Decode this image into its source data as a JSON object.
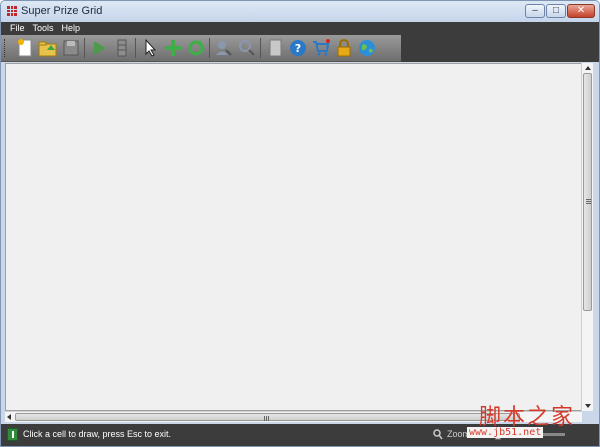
{
  "window": {
    "title": "Super Prize Grid"
  },
  "menu": {
    "items": [
      "File",
      "Tools",
      "Help"
    ]
  },
  "toolbar": {
    "buttons": [
      {
        "name": "new-file-icon"
      },
      {
        "name": "open-folder-icon"
      },
      {
        "name": "save-icon"
      },
      {
        "name": "play-icon"
      },
      {
        "name": "stack-icon"
      },
      {
        "name": "cursor-arrow-icon"
      },
      {
        "name": "move-cross-icon"
      },
      {
        "name": "refresh-icon"
      },
      {
        "name": "user-search-icon"
      },
      {
        "name": "user-zoom-icon"
      },
      {
        "name": "blank-page-icon"
      },
      {
        "name": "help-icon"
      },
      {
        "name": "cart-icon"
      },
      {
        "name": "lock-icon"
      },
      {
        "name": "globe-icon"
      }
    ]
  },
  "status": {
    "message": "Click a cell to draw, press Esc to exit.",
    "zoom_label": "Zoom"
  },
  "watermark": {
    "main": "脚本之家",
    "sub": "www.jb51.net"
  },
  "colors": {
    "menubar": "#3c3c3c",
    "content_bg": "#f0f0f0",
    "accent_green": "#2e8b3a",
    "watermark": "#d43a2a"
  }
}
